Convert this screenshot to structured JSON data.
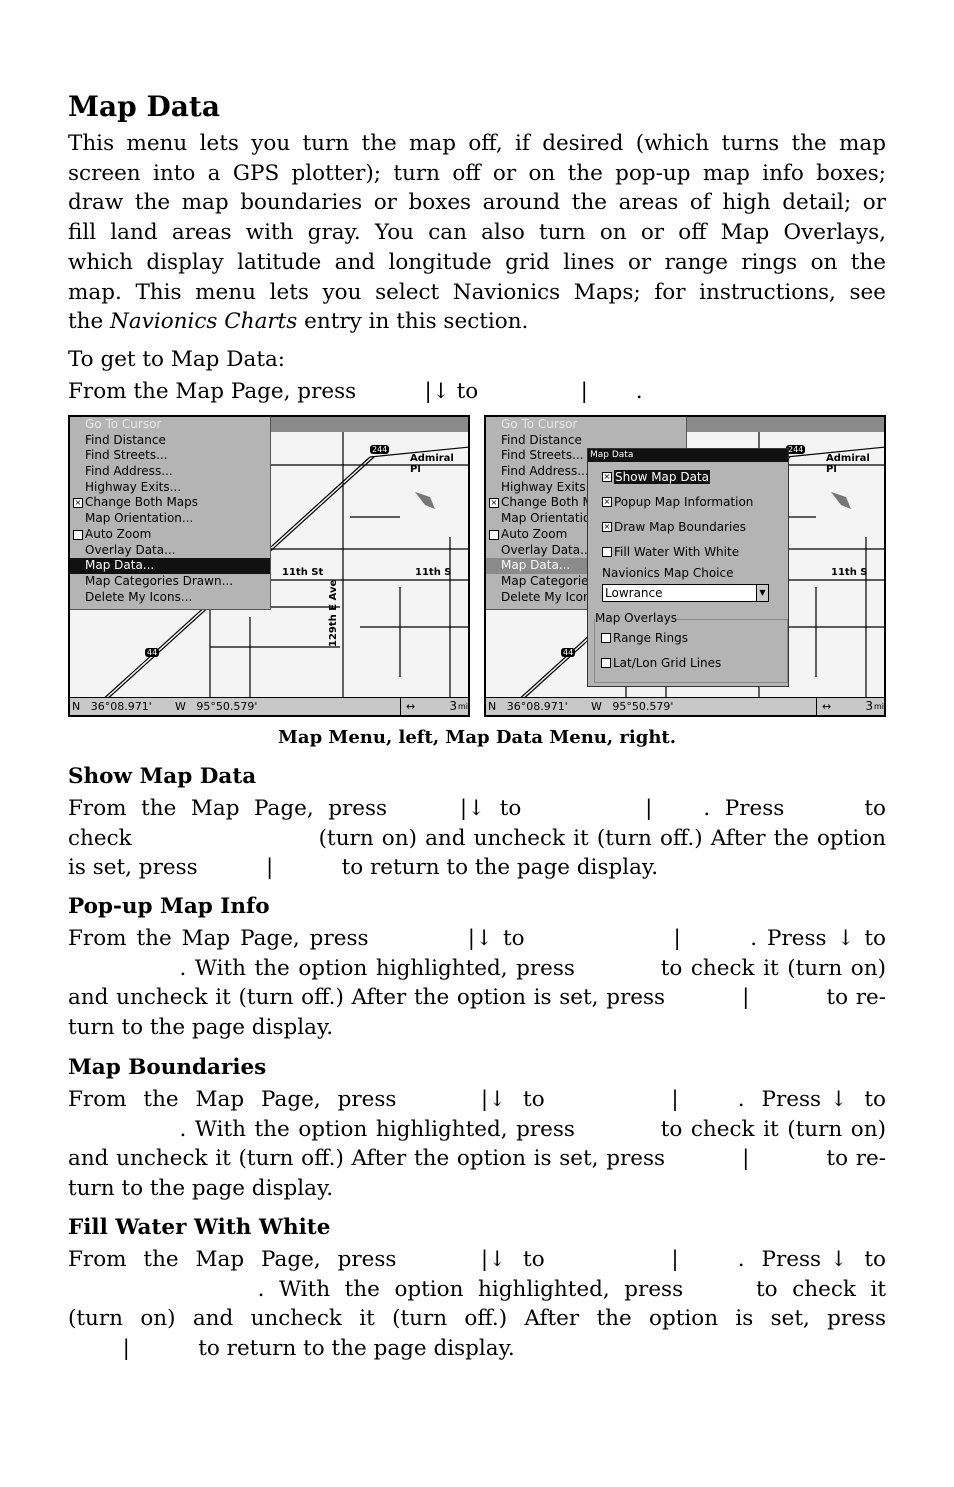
{
  "title": "Map Data",
  "intro": [
    "This menu lets you turn the map off, if desired (which turns the map",
    "screen into a GPS plotter); turn off or on the pop-up map info boxes;",
    "draw the map boundaries or boxes around the areas of high detail; or",
    "fill land areas with gray. You can also turn on or off Map Overlays,",
    "which display latitude and longitude grid lines or range rings on the",
    "map. This menu lets you select Navionics Maps; for instructions, see"
  ],
  "intro_last": {
    "pre": "the ",
    "em": "Navionics Charts",
    "post": " entry in this section."
  },
  "get_to": "To get to Map Data:",
  "get_to_line": "From the Map Page, press          |↓ to               |       .",
  "caption": "Map Menu, left, Map Data Menu, right.",
  "menu": {
    "items": [
      {
        "label": "Go To Cursor",
        "disabled": true
      },
      {
        "label": "Find Distance"
      },
      {
        "label": "Find Streets..."
      },
      {
        "label": "Find Address..."
      },
      {
        "label": "Highway Exits..."
      },
      {
        "label": "Change Both Maps",
        "checked": true
      },
      {
        "label": "Map Orientation..."
      },
      {
        "label": "Auto Zoom",
        "checked": false
      },
      {
        "label": "Overlay Data..."
      },
      {
        "label": "Map Data...",
        "selected": true
      },
      {
        "label": "Map Categories Drawn..."
      },
      {
        "label": "Delete My Icons..."
      }
    ]
  },
  "dialog": {
    "title": "Map Data",
    "options": [
      {
        "label": "Show Map Data",
        "checked": true
      },
      {
        "label": "Popup Map Information",
        "checked": true
      },
      {
        "label": "Draw Map Boundaries",
        "checked": true
      },
      {
        "label": "Fill Water With White",
        "checked": false
      }
    ],
    "navionics_label": "Navionics Map Choice",
    "navionics_value": "Lowrance",
    "overlays_label": "Map Overlays",
    "overlays": [
      {
        "label": "Range Rings",
        "checked": false
      },
      {
        "label": "Lat/Lon Grid Lines",
        "checked": false
      }
    ]
  },
  "map": {
    "labels": [
      "Admiral Pl",
      "miral Pl",
      "11th St",
      "11th S",
      "129th E Ave"
    ],
    "lat": "N   36°08.971'",
    "lon": "W   95°50.579'",
    "scale": "3",
    "scale_unit": "mi",
    "shield1": "244",
    "shield2": "44"
  },
  "sections": [
    {
      "heading": "Show Map Data",
      "lines": [
        "From  the  Map  Page,  press          |↓  to                 |       .  Press           to",
        "check                       (turn on) and uncheck it (turn off.) After the option"
      ],
      "last": "is set, press          |          to return to the page display."
    },
    {
      "heading": "Pop-up Map Info",
      "lines": [
        "From the Map Page, press          |↓ to               |       . Press ↓ to",
        "             . With the option highlighted, press          to check it (turn on)",
        "and uncheck it (turn off.) After the option is set, press          |          to re-"
      ],
      "last": "turn to the page display."
    },
    {
      "heading": "Map Boundaries",
      "lines": [
        "From  the  Map  Page,  press          |↓  to               |       .  Press ↓  to",
        "             . With the option highlighted, press          to check it (turn on)",
        "and uncheck it (turn off.) After the option is set, press          |          to re-"
      ],
      "last": "turn to the page display."
    },
    {
      "heading": "Fill Water With White",
      "lines": [
        "From  the  Map  Page,  press          |↓  to               |       .  Press ↓  to",
        "                          .  With  the  option  highlighted,  press          to  check  it",
        "(turn  on)  and  uncheck  it  (turn  off.)  After  the  option  is  set,  press"
      ],
      "last": "        |          to return to the page display."
    }
  ]
}
